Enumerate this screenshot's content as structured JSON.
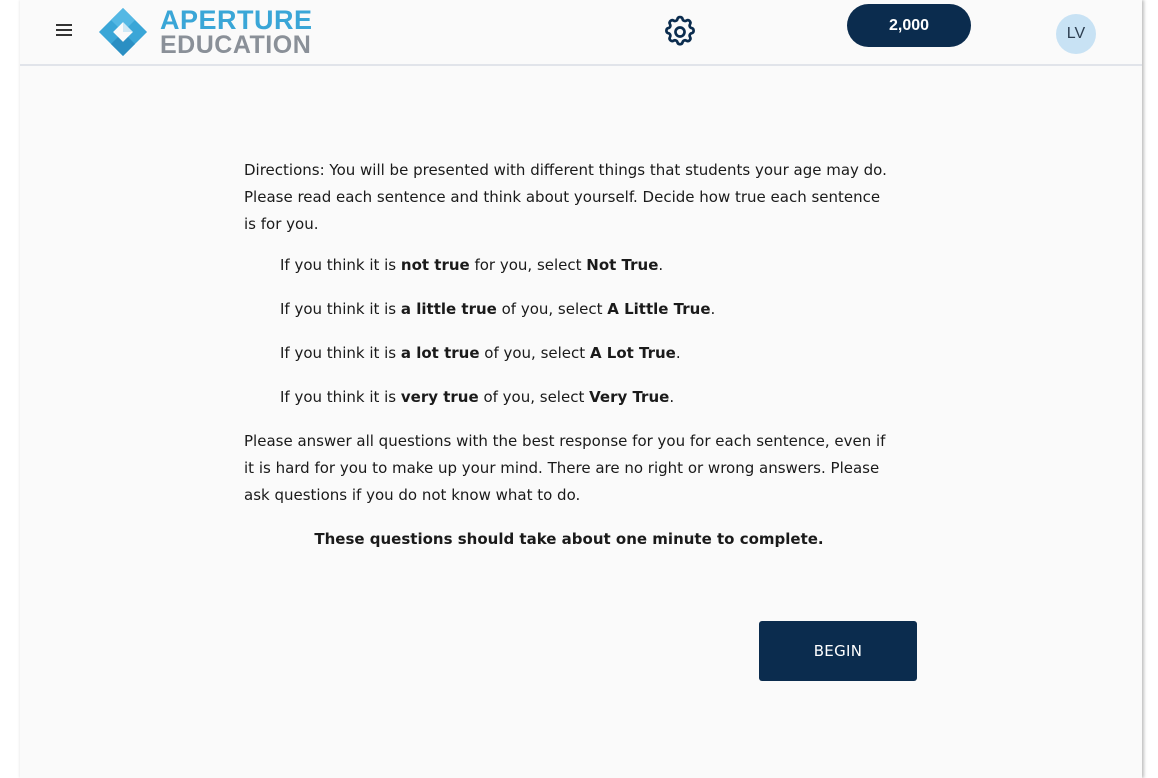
{
  "header": {
    "logo_line1": "APERTURE",
    "logo_line2": "EDUCATION",
    "points": "2,000",
    "avatar_initials": "LV"
  },
  "directions": {
    "intro": "Directions: You will be presented with different things that students your age may do. Please read each sentence and think about yourself. Decide how true each sentence is for you.",
    "options": [
      {
        "pre": "If you think it is ",
        "term": "not true",
        "mid": " for you, select ",
        "choice": "Not True",
        "post": "."
      },
      {
        "pre": "If you think it is ",
        "term": "a little true",
        "mid": " of you, select ",
        "choice": "A Little True",
        "post": "."
      },
      {
        "pre": "If you think it is ",
        "term": "a lot true",
        "mid": " of you, select ",
        "choice": "A Lot True",
        "post": "."
      },
      {
        "pre": "If you think it is ",
        "term": "very true",
        "mid": " of you, select ",
        "choice": "Very True",
        "post": "."
      }
    ],
    "closing": "Please answer all questions with the best response for you for each sentence, even if it is hard for you to make up your mind. There are no right or wrong answers. Please ask questions if you do not know what to do.",
    "time_note": "These questions should take about one minute to complete."
  },
  "actions": {
    "begin_label": "BEGIN"
  },
  "colors": {
    "navy": "#0b2c4e",
    "logo_blue": "#3aa6d7",
    "logo_gray": "#8a9098",
    "avatar_bg": "#c8e2f4"
  },
  "icons": {
    "menu": "hamburger-menu-icon",
    "logo": "aperture-logo-mark",
    "settings": "gear-icon"
  }
}
